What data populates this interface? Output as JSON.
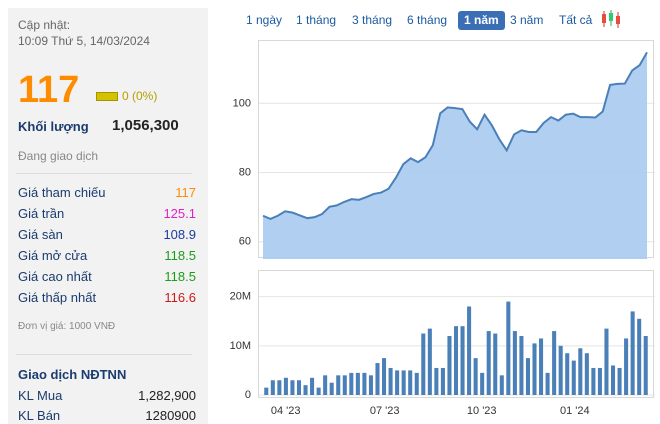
{
  "header": {
    "updated_label": "Cập nhật:",
    "updated_time": "10:09 Thứ 5, 14/03/2024"
  },
  "quote": {
    "price": "117",
    "change": "0 (0%)",
    "volume_label": "Khối lượng",
    "volume_value": "1,056,300",
    "status": "Đang giao dịch"
  },
  "prices": [
    {
      "label": "Giá tham chiếu",
      "value": "117",
      "color": "#ff8c00"
    },
    {
      "label": "Giá trần",
      "value": "125.1",
      "color": "#e020c8"
    },
    {
      "label": "Giá sàn",
      "value": "108.9",
      "color": "#1a3c9e"
    },
    {
      "label": "Giá mở cửa",
      "value": "118.5",
      "color": "#1a9e1a"
    },
    {
      "label": "Giá cao nhất",
      "value": "118.5",
      "color": "#1a9e1a"
    },
    {
      "label": "Giá thấp nhất",
      "value": "116.6",
      "color": "#cc1a1a"
    }
  ],
  "unit_note": "Đơn vị giá: 1000 VNĐ",
  "foreign": {
    "title": "Giao dịch NĐTNN",
    "rows": [
      {
        "label": "KL Mua",
        "value": "1,282,900"
      },
      {
        "label": "KL Bán",
        "value": "1280900"
      }
    ]
  },
  "tabs": [
    "1 ngày",
    "1 tháng",
    "3 tháng",
    "6 tháng",
    "1 năm",
    "3 năm",
    "Tất cả"
  ],
  "active_tab": "1 năm",
  "chart_data": [
    {
      "type": "area",
      "ylim": [
        55,
        118
      ],
      "yticks": [
        60,
        80,
        100
      ],
      "values": [
        67.5,
        66.6,
        67.5,
        68.8,
        68.4,
        67.6,
        66.8,
        67.1,
        68.0,
        70.1,
        70.5,
        71.5,
        72.3,
        72.1,
        72.9,
        73.8,
        74.2,
        75.3,
        78.5,
        82.4,
        84.1,
        83.0,
        84.4,
        87.9,
        97.1,
        98.8,
        98.6,
        98.3,
        94.7,
        92.5,
        96.7,
        93.6,
        89.6,
        86.4,
        91.0,
        92.2,
        91.7,
        91.7,
        94.3,
        96.0,
        95.0,
        96.7,
        97.0,
        96.0,
        96.0,
        95.9,
        97.6,
        105.3,
        105.6,
        105.7,
        109.5,
        111.0,
        114.7
      ],
      "line_color": "#4a7fb8",
      "fill_color": "#a8cbef"
    },
    {
      "type": "bar",
      "ylim": [
        0,
        24
      ],
      "yticks_labels": [
        "0",
        "10M",
        "20M"
      ],
      "yticks": [
        0,
        10,
        20
      ],
      "x_labels": [
        "04 '23",
        "07 '23",
        "10 '23",
        "01 '24"
      ],
      "values": [
        1.5,
        3.0,
        3.0,
        3.5,
        3.0,
        3.0,
        2.0,
        3.5,
        1.5,
        4.0,
        2.5,
        4.0,
        4.0,
        4.5,
        4.5,
        4.5,
        4.0,
        6.5,
        7.5,
        5.5,
        5.0,
        5.0,
        5.0,
        4.5,
        12.5,
        13.5,
        5.5,
        5.5,
        12.0,
        14.0,
        14.0,
        18.0,
        7.5,
        4.5,
        13.0,
        12.5,
        4.0,
        19.0,
        13.0,
        12.0,
        7.5,
        10.5,
        11.5,
        4.5,
        13.0,
        10.0,
        8.5,
        7.0,
        9.5,
        8.5,
        5.5,
        5.5,
        13.5,
        6.0,
        5.5,
        11.5,
        17.0,
        15.5,
        12.0
      ],
      "bar_color": "#4a7fb8"
    }
  ]
}
